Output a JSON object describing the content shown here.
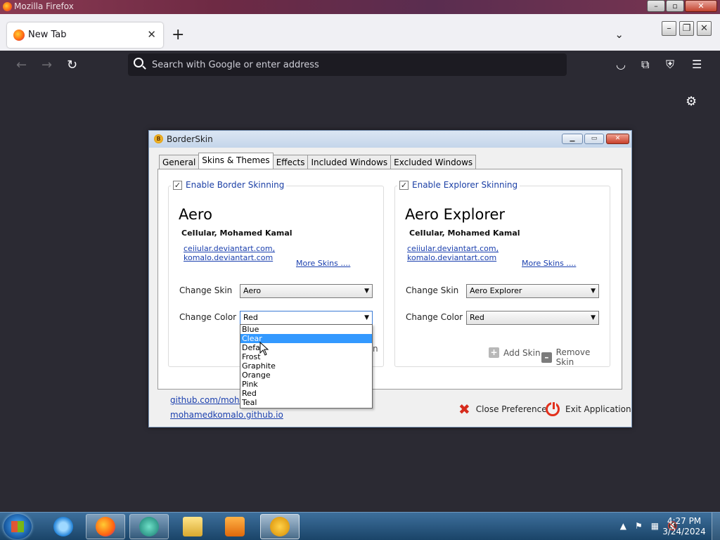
{
  "browser": {
    "window_title": "Mozilla Firefox",
    "tab_label": "New Tab",
    "url_placeholder": "Search with Google or enter address"
  },
  "dialog": {
    "title": "BorderSkin",
    "tabs": [
      "General",
      "Skins & Themes",
      "Effects",
      "Included Windows",
      "Excluded Windows"
    ],
    "active_tab": "Skins & Themes",
    "border_group": {
      "enable_label": "Enable Border Skinning",
      "checked": true,
      "skin_name": "Aero",
      "author": "CeIIular, Mohamed Kamal",
      "link1": "ceiiular.deviantart.com,",
      "link2": "komalo.deviantart.com",
      "more_skins": "More Skins ....",
      "change_skin_label": "Change Skin",
      "skin_value": "Aero",
      "change_color_label": "Change Color",
      "color_value": "Red",
      "hidden_partial": "n"
    },
    "explorer_group": {
      "enable_label": "Enable Explorer Skinning",
      "checked": true,
      "skin_name": "Aero Explorer",
      "author": "CeIIular, Mohamed Kamal",
      "link1": "ceiiular.deviantart.com,",
      "link2": "komalo.deviantart.com",
      "more_skins": "More Skins ....",
      "change_skin_label": "Change Skin",
      "skin_value": "Aero Explorer",
      "change_color_label": "Change Color",
      "color_value": "Red",
      "add_skin": "Add Skin",
      "remove_skin": "Remove Skin"
    },
    "bottom_links": [
      "github.com/moham",
      "mohamedkomalo.github.io"
    ],
    "close_pref": "Close Preference",
    "exit_app": "Exit Application",
    "color_dropdown": {
      "items": [
        "Blue",
        "Clear",
        "Defau",
        "Frost",
        "Graphite",
        "Orange",
        "Pink",
        "Red",
        "Teal"
      ],
      "highlighted": "Clear"
    }
  },
  "taskbar": {
    "time": "4:27 PM",
    "date": "3/24/2024"
  }
}
